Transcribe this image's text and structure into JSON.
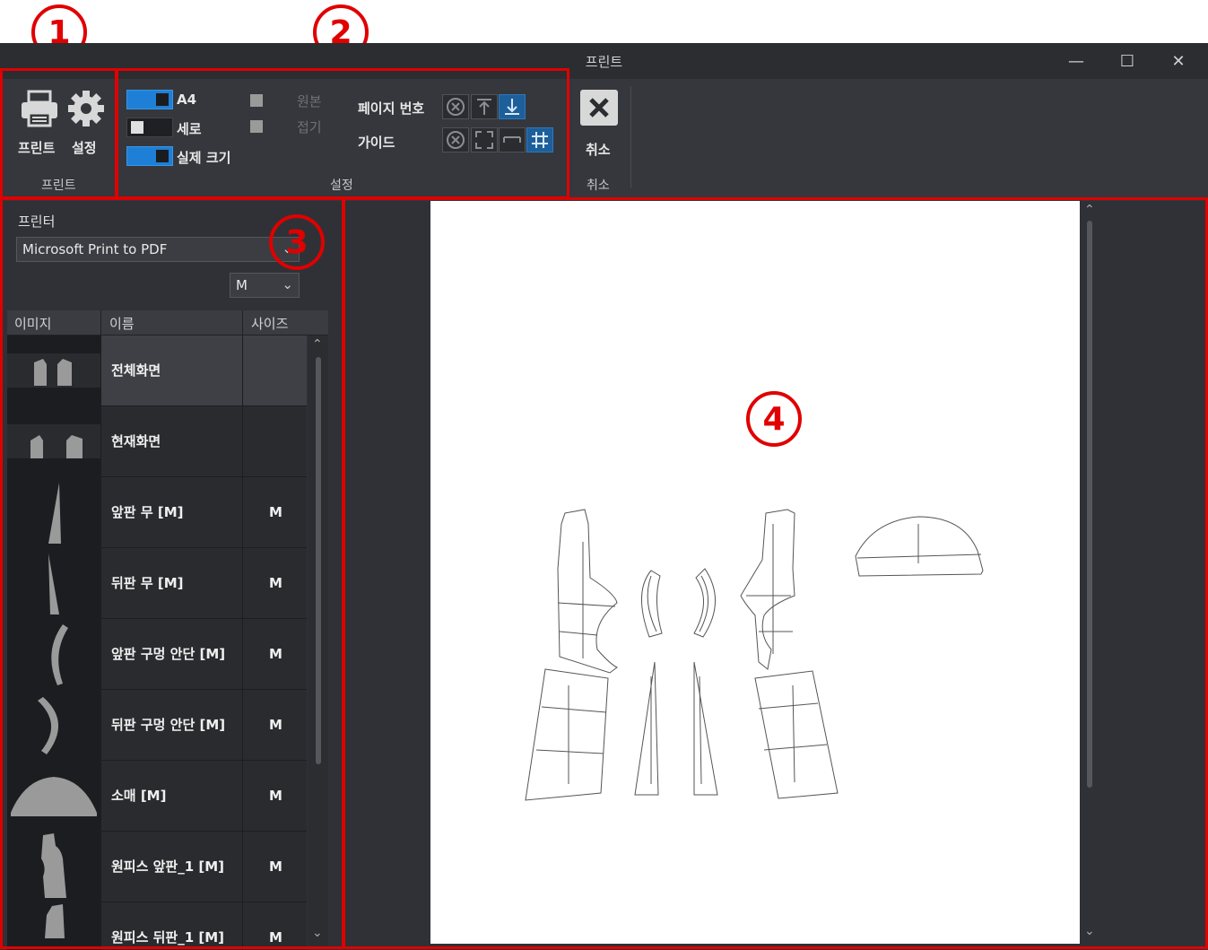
{
  "callouts": [
    "1",
    "2",
    "3",
    "4"
  ],
  "window": {
    "title": "프린트",
    "controls": {
      "minimize": "—",
      "maximize": "☐",
      "close": "✕"
    }
  },
  "ribbon": {
    "print_group": {
      "print_label": "프린트",
      "settings_label": "설정",
      "group_label": "프린트"
    },
    "settings_group": {
      "a4_label": "A4",
      "portrait_label": "세로",
      "actual_size_label": "실제 크기",
      "original_label": "원본",
      "fold_label": "접기",
      "page_number_label": "페이지 번호",
      "guide_label": "가이드",
      "group_label": "설정"
    },
    "cancel_group": {
      "cancel_label": "취소",
      "group_label": "취소"
    }
  },
  "left_panel": {
    "printer_label": "프린터",
    "printer_value": "Microsoft Print to PDF",
    "size_value": "M",
    "columns": [
      "이미지",
      "이름",
      "사이즈"
    ],
    "rows": [
      {
        "name": "전체화면",
        "size": ""
      },
      {
        "name": "현재화면",
        "size": ""
      },
      {
        "name": "앞판 무 [M]",
        "size": "M"
      },
      {
        "name": "뒤판 무 [M]",
        "size": "M"
      },
      {
        "name": "앞판 구멍 안단 [M]",
        "size": "M"
      },
      {
        "name": "뒤판 구멍 안단 [M]",
        "size": "M"
      },
      {
        "name": "소매 [M]",
        "size": "M"
      },
      {
        "name": "원피스 앞판_1 [M]",
        "size": "M"
      },
      {
        "name": "원피스 뒤판_1 [M]",
        "size": "M"
      }
    ]
  },
  "colors": {
    "accent": "#1e7fd6",
    "annotation": "#e00000",
    "background": "#2f3136"
  },
  "icons": [
    "printer-icon",
    "gear-icon",
    "close-x-icon",
    "chevron-down-icon",
    "chevron-up-icon"
  ]
}
